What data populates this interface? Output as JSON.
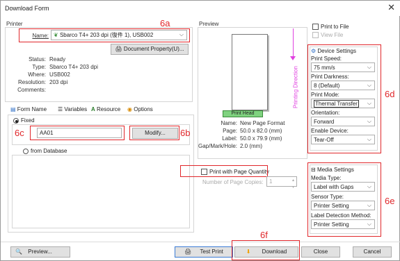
{
  "window": {
    "title": "Download Form",
    "close_glyph": "✕"
  },
  "printer": {
    "group_title": "Printer",
    "name_label": "Name:",
    "name_value": "Sbarco T4+ 203 dpi (復件 1),  USB002",
    "document_property_label": "Document Property(U)...",
    "status_label": "Status:",
    "status_value": "Ready",
    "type_label": "Type:",
    "type_value": "Sbarco T4+ 203 dpi",
    "where_label": "Where:",
    "where_value": "USB002",
    "resolution_label": "Resolution:",
    "resolution_value": "203 dpi",
    "comments_label": "Comments:",
    "comments_value": ""
  },
  "tabs": {
    "form_name": "Form Name",
    "variables": "Variables",
    "resource": "Resource",
    "options": "Options"
  },
  "form": {
    "fixed_label": "Fixed",
    "fixed_value": "AA01",
    "modify_label": "Modify...",
    "from_database_label": "from Database"
  },
  "preview": {
    "title": "Preview",
    "print_head_label": "Print Head",
    "printing_direction": "Printing Direction",
    "name_label": "Name:",
    "name_value": "New Page Format",
    "page_label": "Page:",
    "page_value": "50.0  x  82.0   (mm)",
    "label_label": "Label:",
    "label_value": "50.0  x  79.9   (mm)",
    "gap_label": "Gap/Mark/Hole:",
    "gap_value": "2.0   (mm)"
  },
  "quantity": {
    "print_with_page_quantity": "Print with Page Quantity",
    "copies_label": "Number of Page Copies:",
    "copies_value": "1"
  },
  "print_to_file": {
    "label": "Print to File",
    "view_file": "View File"
  },
  "device": {
    "title": "Device Settings",
    "speed_label": "Print Speed:",
    "speed_value": "75  mm/s",
    "darkness_label": "Print Darkness:",
    "darkness_value": "8 (Default)",
    "mode_label": "Print Mode:",
    "mode_value": "Thermal Transfer",
    "orientation_label": "Orientation:",
    "orientation_value": "Forward",
    "enable_label": "Enable Device:",
    "enable_value": "Tear-Off"
  },
  "media": {
    "title": "Media Settings",
    "type_label": "Media Type:",
    "type_value": "Label with Gaps",
    "sensor_label": "Sensor Type:",
    "sensor_value": "Printer Setting",
    "detection_label": "Label Detection Method:",
    "detection_value": "Printer Setting"
  },
  "buttons": {
    "preview": "Preview...",
    "test_print": "Test Print",
    "download": "Download",
    "close": "Close",
    "cancel": "Cancel"
  },
  "callouts": {
    "a": "6a",
    "b": "6b",
    "c": "6c",
    "d": "6d",
    "e": "6e",
    "f": "6f"
  },
  "icons": [
    "leaf-printer-icon",
    "printer-property-icon",
    "form-icon",
    "list-icon",
    "resource-a-icon",
    "options-icon",
    "settings-icon",
    "media-icon",
    "preview-magnifier-icon",
    "test-print-icon",
    "download-icon"
  ],
  "colors": {
    "callout_red": "#e0262a",
    "print_head_green": "#7fd27f",
    "direction_magenta": "#e040e0"
  }
}
